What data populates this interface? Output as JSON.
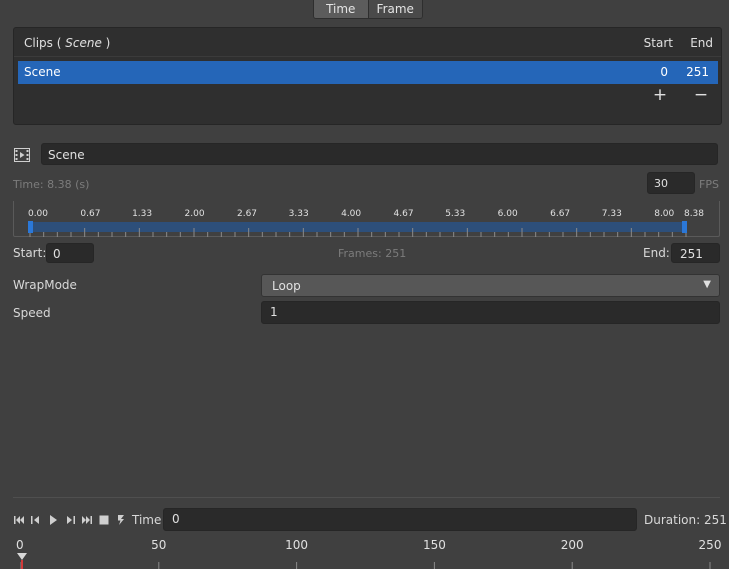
{
  "top_tabs": {
    "time": "Time",
    "frame": "Frame",
    "active": "time"
  },
  "clips": {
    "title_prefix": "Clips (",
    "title_scene": " Scene ",
    "title_suffix": ")",
    "col_start": "Start",
    "col_end": "End",
    "rows": [
      {
        "name": "Scene",
        "start": "0",
        "end": "251"
      }
    ],
    "add_label": "+",
    "remove_label": "−"
  },
  "clip_editor": {
    "icon": "film-icon",
    "name_value": "Scene",
    "time_text": "Time: 8.38 (s)",
    "fps_value": "30",
    "fps_label": "FPS",
    "ruler_ticks": [
      "0.00",
      "0.67",
      "1.33",
      "2.00",
      "2.67",
      "3.33",
      "4.00",
      "4.67",
      "5.33",
      "6.00",
      "6.67",
      "7.33",
      "8.00",
      "8.38"
    ],
    "start_label": "Start:",
    "start_value": "0",
    "frames_text": "Frames: 251",
    "end_label": "End:",
    "end_value": "251"
  },
  "properties": {
    "wrapmode_label": "WrapMode",
    "wrapmode_value": "Loop",
    "speed_label": "Speed",
    "speed_value": "1"
  },
  "playback": {
    "icons": [
      "skip-to-start-icon",
      "step-back-icon",
      "play-icon",
      "step-forward-icon",
      "skip-to-end-icon",
      "stop-icon",
      "record-key-icon"
    ],
    "time_label": "Time",
    "time_value": "0",
    "duration_text": "Duration: 251"
  },
  "timeline": {
    "labels": [
      "0",
      "50",
      "100",
      "150",
      "200",
      "250"
    ],
    "playhead_frame": 0
  },
  "colors": {
    "accent": "#2566b8",
    "playhead": "#d33a3a"
  }
}
